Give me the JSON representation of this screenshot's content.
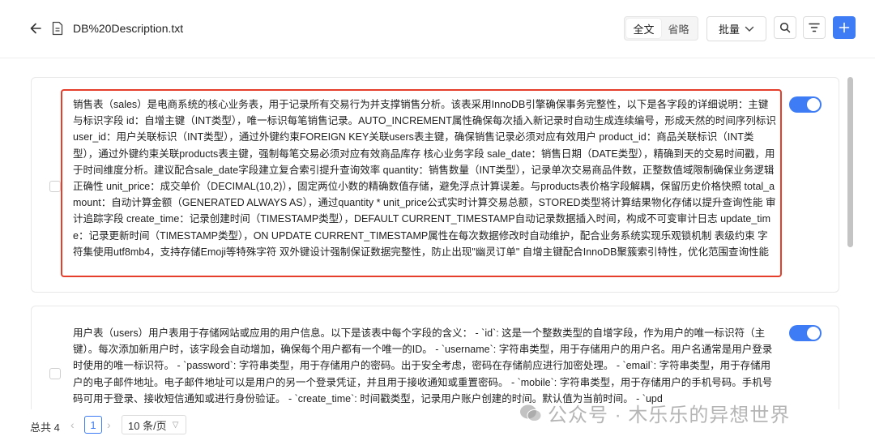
{
  "header": {
    "file_name": "DB%20Description.txt",
    "segment": {
      "full_label": "全文",
      "omit_label": "省略"
    },
    "batch_label": "批量"
  },
  "colors": {
    "accent": "#3d7cf5",
    "highlight_border": "#e53e2b"
  },
  "icons": {
    "back": "arrow-left-icon",
    "file": "file-icon",
    "search": "search-icon",
    "filter": "filter-icon",
    "add": "plus-icon",
    "batch_chevron": "chevron-down-icon"
  },
  "cards": [
    {
      "text": "销售表（sales）是电商系统的核心业务表，用于记录所有交易行为并支撑销售分析。该表采用InnoDB引擎确保事务完整性，以下是各字段的详细说明：主键与标识字段 id：自增主键（INT类型），唯一标识每笔销售记录。AUTO_INCREMENT属性确保每次插入新记录时自动生成连续编号，形成天然的时间序列标识 user_id：用户关联标识（INT类型），通过外键约束FOREIGN KEY关联users表主键，确保销售记录必须对应有效用户 product_id：商品关联标识（INT类型），通过外键约束关联products表主键，强制每笔交易必须对应有效商品库存 核心业务字段 sale_date：销售日期（DATE类型），精确到天的交易时间戳，用于时间维度分析。建议配合sale_date字段建立复合索引提升查询效率 quantity：销售数量（INT类型），记录单次交易商品件数，正整数值域限制确保业务逻辑正确性 unit_price：成交单价（DECIMAL(10,2)），固定两位小数的精确数值存储，避免浮点计算误差。与products表价格字段解耦，保留历史价格快照 total_amount：自动计算金额（GENERATED ALWAYS AS），通过quantity * unit_price公式实时计算交易总额，STORED类型将计算结果物化存储以提升查询性能 审计追踪字段 create_time：记录创建时间（TIMESTAMP类型），DEFAULT CURRENT_TIMESTAMP自动记录数据插入时间，构成不可变审计日志 update_time：记录更新时间（TIMESTAMP类型），ON UPDATE CURRENT_TIMESTAMP属性在每次数据修改时自动维护，配合业务系统实现乐观锁机制 表级约束 字符集使用utf8mb4，支持存储Emoji等特殊字符 双外键设计强制保证数据完整性，防止出现\"幽灵订单\" 自增主键配合InnoDB聚簇索引特性，优化范围查询性能",
      "enabled": true
    },
    {
      "text": "用户表（users）用户表用于存储网站或应用的用户信息。以下是该表中每个字段的含义： - `id`: 这是一个整数类型的自增字段，作为用户的唯一标识符（主键）。每次添加新用户时，该字段会自动增加，确保每个用户都有一个唯一的ID。 - `username`: 字符串类型，用于存储用户的用户名。用户名通常是用户登录时使用的唯一标识符。 - `password`: 字符串类型，用于存储用户的密码。出于安全考虑，密码在存储前应进行加密处理。 - `email`: 字符串类型，用于存储用户的电子邮件地址。电子邮件地址可以是用户的另一个登录凭证，并且用于接收通知或重置密码。 - `mobile`: 字符串类型，用于存储用户的手机号码。手机号码可用于登录、接收短信通知或进行身份验证。 - `create_time`: 时间戳类型，记录用户账户创建的时间。默认值为当前时间。 - `upd",
      "enabled": true
    }
  ],
  "footer": {
    "total_label": "总共 4",
    "current_page": "1",
    "page_size": "10 条/页"
  },
  "watermark": "公众号 · 木乐乐的异想世界"
}
